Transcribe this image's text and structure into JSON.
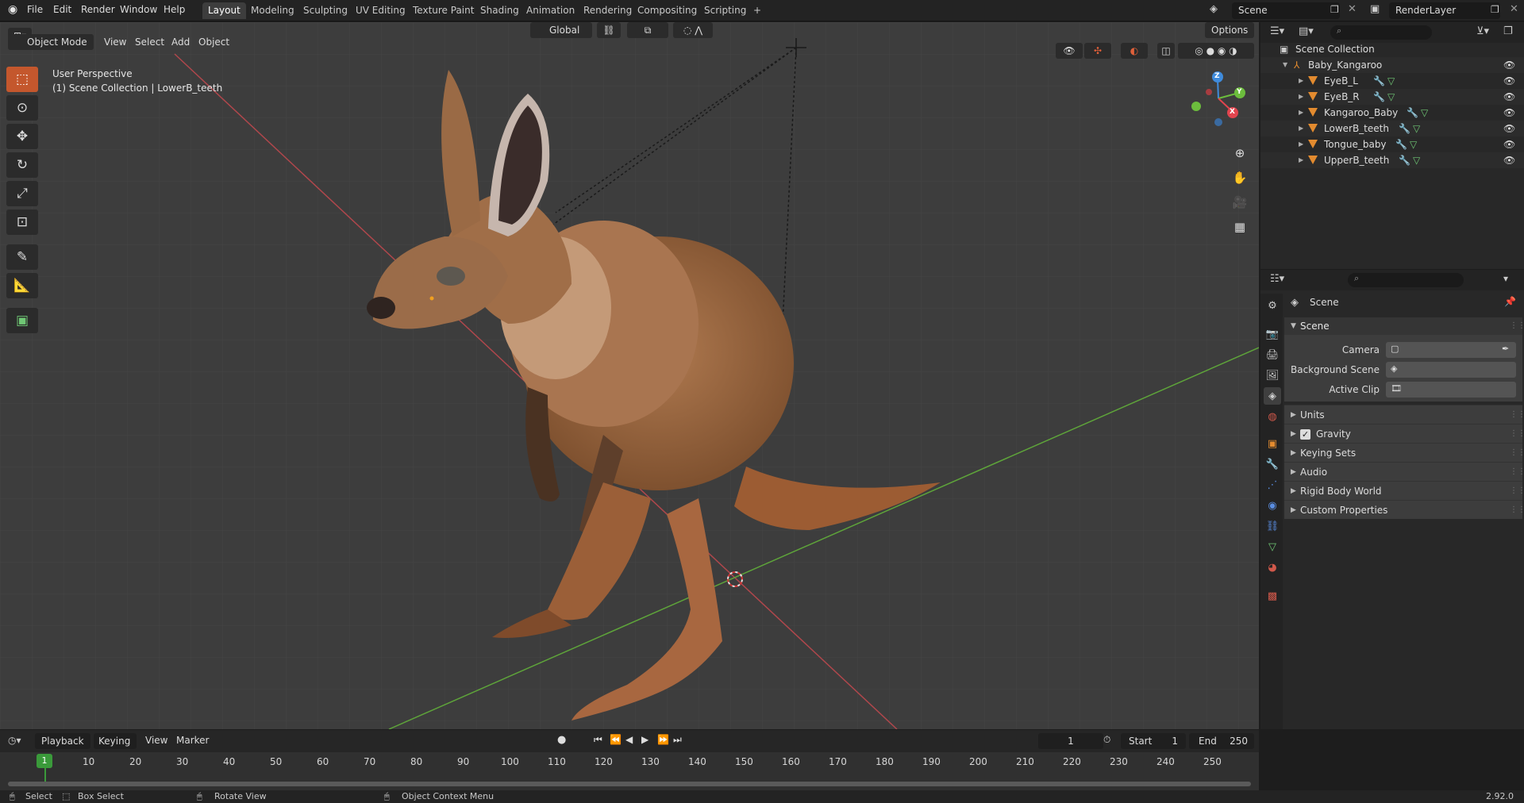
{
  "menu": {
    "items": [
      "File",
      "Edit",
      "Render",
      "Window",
      "Help"
    ]
  },
  "workspaces": [
    "Layout",
    "Modeling",
    "Sculpting",
    "UV Editing",
    "Texture Paint",
    "Shading",
    "Animation",
    "Rendering",
    "Compositing",
    "Scripting"
  ],
  "active_workspace": "Layout",
  "add_tab_symbol": "+",
  "scene_selector": {
    "value": "Scene"
  },
  "view_layer_selector": {
    "value": "RenderLayer"
  },
  "viewport": {
    "mode": "Object Mode",
    "header_menus": [
      "View",
      "Select",
      "Add",
      "Object"
    ],
    "transform_orientation": "Global",
    "options_label": "Options",
    "overlay_line1": "User Perspective",
    "overlay_line2": "(1) Scene Collection | LowerB_teeth",
    "gizmo_axes": {
      "z": "Z",
      "y": "Y",
      "x": "X"
    }
  },
  "outliner": {
    "root": "Scene Collection",
    "collection": "Baby_Kangaroo",
    "objects": [
      "EyeB_L",
      "EyeB_R",
      "Kangaroo_Baby",
      "LowerB_teeth",
      "Tongue_baby",
      "UpperB_teeth"
    ]
  },
  "properties": {
    "context_title": "Scene",
    "section_title": "Scene",
    "camera_label": "Camera",
    "background_scene_label": "Background Scene",
    "active_clip_label": "Active Clip",
    "subpanels": [
      "Units",
      "Gravity",
      "Keying Sets",
      "Audio",
      "Rigid Body World",
      "Custom Properties"
    ],
    "gravity_checked": true
  },
  "timeline": {
    "menus": [
      "Playback",
      "Keying",
      "View",
      "Marker"
    ],
    "current_frame": "1",
    "start_label": "Start",
    "start_value": "1",
    "end_label": "End",
    "end_value": "250",
    "ticks": [
      "1",
      "10",
      "20",
      "30",
      "40",
      "50",
      "60",
      "70",
      "80",
      "90",
      "100",
      "110",
      "120",
      "130",
      "140",
      "150",
      "160",
      "170",
      "180",
      "190",
      "200",
      "210",
      "220",
      "230",
      "240",
      "250"
    ]
  },
  "statusbar": {
    "select": "Select",
    "box_select": "Box Select",
    "rotate_view": "Rotate View",
    "context_menu": "Object Context Menu",
    "version": "2.92.0"
  },
  "colors": {
    "accent": "#c4572d",
    "object_orange": "#e38b2f",
    "x_axis": "#e2444e",
    "y_axis": "#6cbd3d",
    "z_axis": "#3f8bdc"
  }
}
